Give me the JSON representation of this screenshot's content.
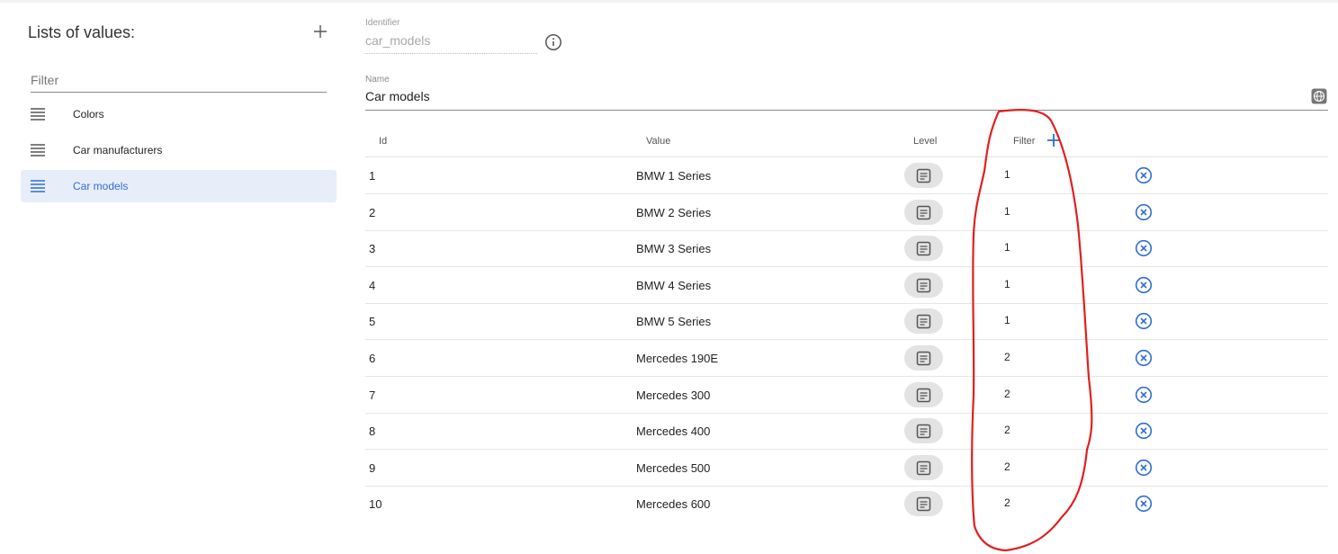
{
  "sidebar": {
    "title": "Lists of values:",
    "add_icon": "plus-icon",
    "filter_placeholder": "Filter",
    "items": [
      {
        "label": "Colors",
        "icon": "list-icon",
        "active": false
      },
      {
        "label": "Car manufacturers",
        "icon": "list-icon",
        "active": false
      },
      {
        "label": "Car models",
        "icon": "list-icon",
        "active": true
      }
    ]
  },
  "form": {
    "identifier_label": "Identifier",
    "identifier_value": "car_models",
    "info_icon": "info-icon",
    "name_label": "Name",
    "name_value": "Car models",
    "globe_icon": "globe-icon"
  },
  "table": {
    "headers": {
      "id": "Id",
      "value": "Value",
      "level": "Level",
      "filter": "Filter"
    },
    "rows": [
      {
        "id": "1",
        "value": "BMW 1 Series",
        "filter": "1"
      },
      {
        "id": "2",
        "value": "BMW 2 Series",
        "filter": "1"
      },
      {
        "id": "3",
        "value": "BMW 3 Series",
        "filter": "1"
      },
      {
        "id": "4",
        "value": "BMW 4 Series",
        "filter": "1"
      },
      {
        "id": "5",
        "value": "BMW 5 Series",
        "filter": "1"
      },
      {
        "id": "6",
        "value": "Mercedes 190E",
        "filter": "2"
      },
      {
        "id": "7",
        "value": "Mercedes 300",
        "filter": "2"
      },
      {
        "id": "8",
        "value": "Mercedes 400",
        "filter": "2"
      },
      {
        "id": "9",
        "value": "Mercedes 500",
        "filter": "2"
      },
      {
        "id": "10",
        "value": "Mercedes 600",
        "filter": "2"
      }
    ]
  },
  "colors": {
    "accent": "#2f6dd3",
    "active_bg": "#e7eef9",
    "annotation": "#e0201e"
  }
}
